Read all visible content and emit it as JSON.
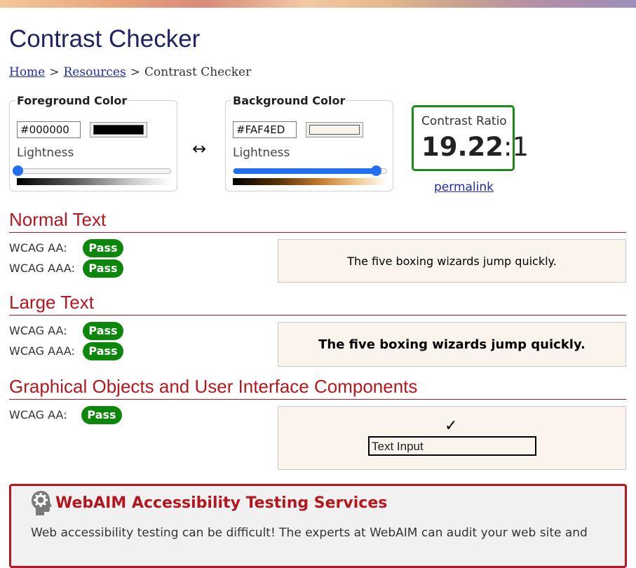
{
  "page": {
    "title": "Contrast Checker"
  },
  "breadcrumb": {
    "home": "Home",
    "sep1": ">",
    "resources": "Resources",
    "sep2": ">",
    "current": "Contrast Checker"
  },
  "foreground": {
    "legend": "Foreground Color",
    "hex": "#000000",
    "swatch_color": "#000000",
    "lightness_label": "Lightness",
    "lightness_level": 0
  },
  "swap": {
    "icon": "↔"
  },
  "background": {
    "legend": "Background Color",
    "hex": "#FAF4ED",
    "swatch_color": "#FAF4ED",
    "lightness_label": "Lightness",
    "lightness_level": 0.93
  },
  "ratio": {
    "label": "Contrast Ratio",
    "value": "19.22",
    "suffix": ":1",
    "permalink": "permalink"
  },
  "sections": {
    "normal": {
      "title": "Normal Text",
      "aa_label": "WCAG AA:",
      "aa_result": "Pass",
      "aaa_label": "WCAG AAA:",
      "aaa_result": "Pass",
      "sample": "The five boxing wizards jump quickly."
    },
    "large": {
      "title": "Large Text",
      "aa_label": "WCAG AA:",
      "aa_result": "Pass",
      "aaa_label": "WCAG AAA:",
      "aaa_result": "Pass",
      "sample": "The five boxing wizards jump quickly."
    },
    "graphical": {
      "title": "Graphical Objects and User Interface Components",
      "aa_label": "WCAG AA:",
      "aa_result": "Pass",
      "check": "✓",
      "input_value": "Text Input"
    }
  },
  "promo": {
    "title": "WebAIM Accessibility Testing Services",
    "text": "Web accessibility testing can be difficult! The experts at WebAIM can audit your web site and"
  },
  "colors": {
    "pass": "#0c870c",
    "heading": "#b5171f",
    "link": "#1f2aa3",
    "title": "#1f2361",
    "ratio_border": "#1a8a1a"
  }
}
